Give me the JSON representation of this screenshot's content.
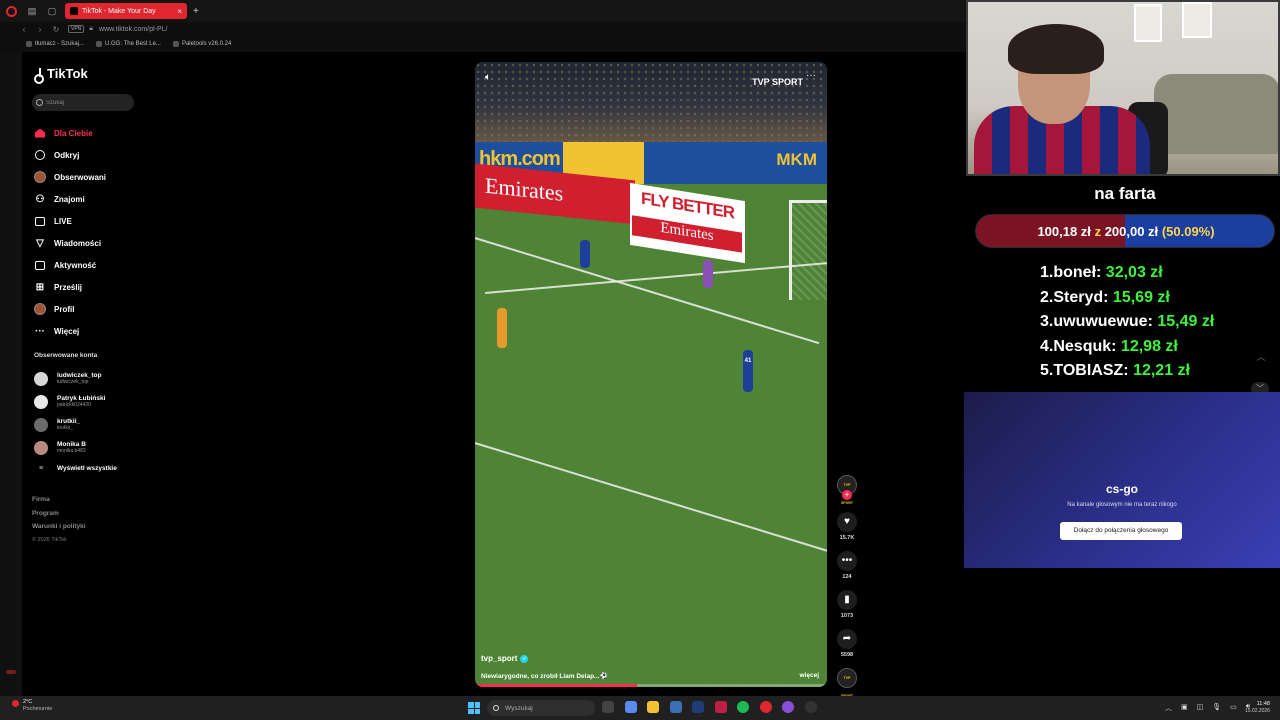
{
  "browser": {
    "tab_title": "TikTok - Make Your Day",
    "url": "www.tiktok.com/pl-PL/",
    "vpn_label": "VPN",
    "bookmarks": [
      "tłumacz - Szukaj...",
      "U.GG: The Best Le...",
      "Paletools v26.0.24"
    ]
  },
  "tiktok": {
    "logo": "TikTok",
    "search_placeholder": "Szukaj",
    "nav": [
      {
        "label": "Dla Ciebie",
        "icon": "home-icon"
      },
      {
        "label": "Odkryj",
        "icon": "compass-icon"
      },
      {
        "label": "Obserwowani",
        "icon": "avatar-icon"
      },
      {
        "label": "Znajomi",
        "icon": "friends-icon"
      },
      {
        "label": "LIVE",
        "icon": "live-icon"
      },
      {
        "label": "Wiadomości",
        "icon": "messages-icon"
      },
      {
        "label": "Aktywność",
        "icon": "activity-icon"
      },
      {
        "label": "Prześlij",
        "icon": "upload-icon"
      },
      {
        "label": "Profil",
        "icon": "profile-icon"
      },
      {
        "label": "Więcej",
        "icon": "more-icon"
      }
    ],
    "followed_title": "Obserwowane konta",
    "followed": [
      {
        "name": "ludwiczek_top",
        "handle": "ludwiczek_top"
      },
      {
        "name": "Patryk Łubiński",
        "handle": "patrickk024420"
      },
      {
        "name": "krutkii_",
        "handle": "krutkii_"
      },
      {
        "name": "Monika B",
        "handle": "monika.b483"
      }
    ],
    "show_all": "Wyświetl wszystkie",
    "footer": [
      "Firma",
      "Program",
      "Warunki i polityki"
    ],
    "copyright": "© 2026 TikTok"
  },
  "video": {
    "brand": "TVP SPORT",
    "board_left": "hkm.com",
    "board_right": "MKM",
    "emirates": "Emirates",
    "fly_better": "FLY BETTER",
    "emirates2": "Emirates",
    "player_number": "41",
    "author": "tvp_sport",
    "caption": "Niewiarygodne, co zrobił Liam Delap...⚽",
    "more": "więcej",
    "progress": 0.46,
    "likes": "15.7K",
    "comments": "124",
    "saves": "1073",
    "shares": "5598",
    "avatar_label": "TVP SPORT"
  },
  "goal": {
    "title": "na farta",
    "current": "100,18 zł",
    "separator": "z",
    "target": "200,00 zł",
    "percent": "(50.09%)",
    "fraction": 0.5009
  },
  "donors": [
    {
      "rank": "1.",
      "name": "boneł:",
      "amount": "32,03 zł"
    },
    {
      "rank": "2.",
      "name": "Steryd:",
      "amount": "15,69 zł"
    },
    {
      "rank": "3.",
      "name": "uwuwuewue:",
      "amount": "15,49 zł"
    },
    {
      "rank": "4.",
      "name": "Nesquk:",
      "amount": "12,98 zł"
    },
    {
      "rank": "5.",
      "name": "TOBIASZ:",
      "amount": "12,21 zł"
    }
  ],
  "discord": {
    "title": "cs-go",
    "subtitle": "Na kanale głosowym nie ma teraz nikogo",
    "button": "Dołącz do połączenia głosowego"
  },
  "taskbar": {
    "temp": "2°C",
    "weather": "Pochmurnie",
    "search_placeholder": "Wyszukaj",
    "time": "11:48",
    "date": "15.02.2026"
  },
  "colors": {
    "accent": "#fe2c55",
    "donation_green": "#3df43d",
    "goal_fill": "#7a1424",
    "goal_bg": "#1b3fa0"
  }
}
